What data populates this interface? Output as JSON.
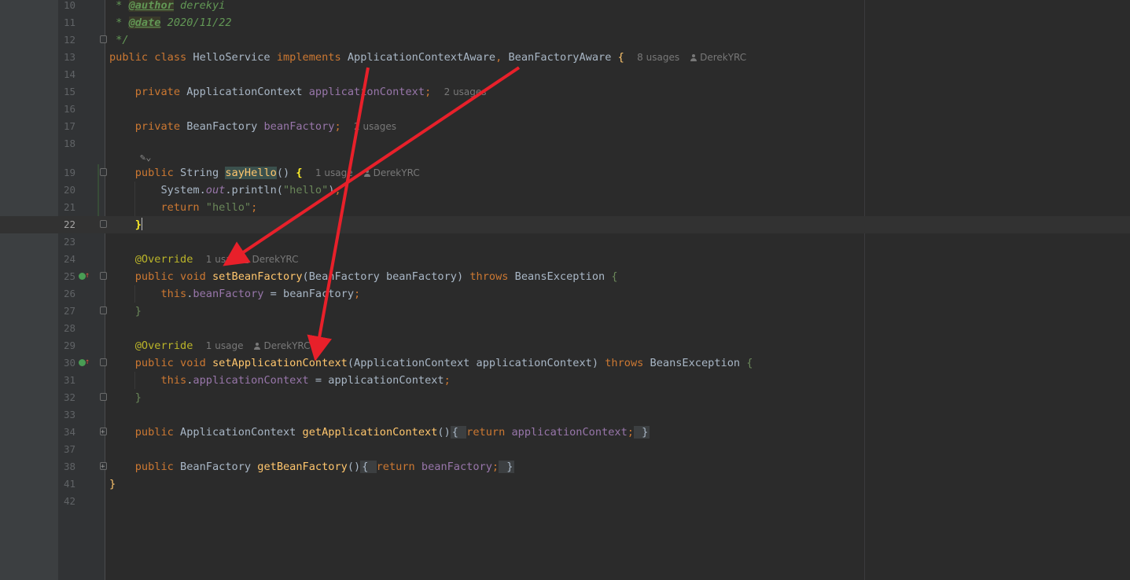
{
  "editor": {
    "current_line": "22",
    "hints": {
      "usages_8": "8 usages",
      "usages_2": "2 usages",
      "usage_1": "1 usage",
      "usage_1_partial": "1 usa",
      "usages_partial": "2 usages",
      "author": "DerekYRC"
    },
    "ai_icon": "ai-assistant-icon",
    "lines": [
      {
        "n": "10",
        "code": " * @author derekyi"
      },
      {
        "n": "11",
        "code": " * @date 2020/11/22"
      },
      {
        "n": "12",
        "code": " */"
      },
      {
        "n": "13",
        "code": "public class HelloService implements ApplicationContextAware, BeanFactoryAware {"
      },
      {
        "n": "14",
        "code": ""
      },
      {
        "n": "15",
        "code": "    private ApplicationContext applicationContext;"
      },
      {
        "n": "16",
        "code": ""
      },
      {
        "n": "17",
        "code": "    private BeanFactory beanFactory;"
      },
      {
        "n": "18",
        "code": ""
      },
      {
        "n": "19",
        "code": "    public String sayHello() {"
      },
      {
        "n": "20",
        "code": "        System.out.println(\"hello\");"
      },
      {
        "n": "21",
        "code": "        return \"hello\";"
      },
      {
        "n": "22",
        "code": "    }"
      },
      {
        "n": "23",
        "code": ""
      },
      {
        "n": "24",
        "code": "    @Override"
      },
      {
        "n": "25",
        "code": "    public void setBeanFactory(BeanFactory beanFactory) throws BeansException {"
      },
      {
        "n": "26",
        "code": "        this.beanFactory = beanFactory;"
      },
      {
        "n": "27",
        "code": "    }"
      },
      {
        "n": "28",
        "code": ""
      },
      {
        "n": "29",
        "code": "    @Override"
      },
      {
        "n": "30",
        "code": "    public void setApplicationContext(ApplicationContext applicationContext) throws BeansException {"
      },
      {
        "n": "31",
        "code": "        this.applicationContext = applicationContext;"
      },
      {
        "n": "32",
        "code": "    }"
      },
      {
        "n": "33",
        "code": ""
      },
      {
        "n": "34",
        "code": "    public ApplicationContext getApplicationContext() { return applicationContext; }"
      },
      {
        "n": "37",
        "code": ""
      },
      {
        "n": "38",
        "code": "    public BeanFactory getBeanFactory() { return beanFactory; }"
      },
      {
        "n": "41",
        "code": "}"
      },
      {
        "n": "42",
        "code": ""
      }
    ]
  },
  "annotation_arrows": {
    "color": "#e8202a",
    "count": 2
  }
}
